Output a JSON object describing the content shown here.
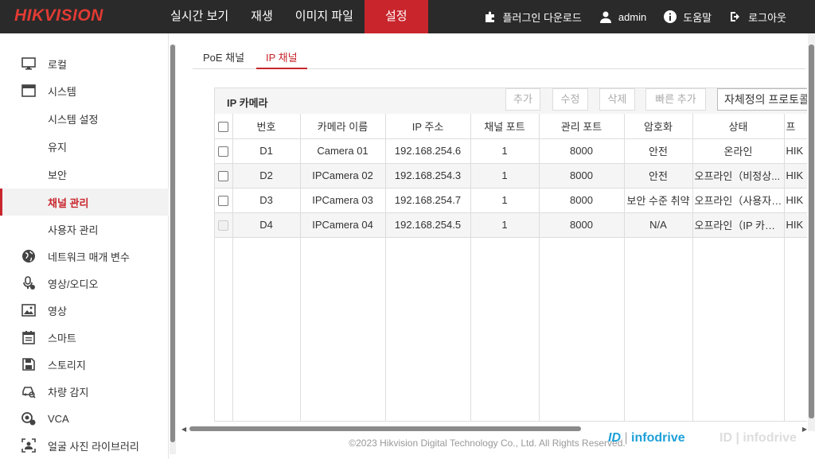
{
  "brand": "HIKVISION",
  "nav": [
    "실시간 보기",
    "재생",
    "이미지 파일",
    "설정"
  ],
  "top_right": {
    "plugin": "플러그인 다운로드",
    "user": "admin",
    "help": "도움말",
    "logout": "로그아웃"
  },
  "sidebar": {
    "items": [
      {
        "label": "로컬",
        "icon": "monitor-icon"
      },
      {
        "label": "시스템",
        "icon": "window-icon"
      },
      {
        "label": "시스템 설정"
      },
      {
        "label": "유지"
      },
      {
        "label": "보안"
      },
      {
        "label": "채널 관리"
      },
      {
        "label": "사용자 관리"
      },
      {
        "label": "네트워크 매개 변수",
        "icon": "globe-icon"
      },
      {
        "label": "영상/오디오",
        "icon": "microphone-icon"
      },
      {
        "label": "영상",
        "icon": "image-icon"
      },
      {
        "label": "스마트",
        "icon": "calendar-icon"
      },
      {
        "label": "스토리지",
        "icon": "floppy-icon"
      },
      {
        "label": "차량 감지",
        "icon": "car-search-icon"
      },
      {
        "label": "VCA",
        "icon": "camera-gear-icon"
      },
      {
        "label": "얼굴 사진 라이브러리",
        "icon": "face-frame-icon"
      }
    ]
  },
  "tabs": [
    "PoE 채널",
    "IP 채널"
  ],
  "panel": {
    "title": "IP 카메라",
    "buttons": [
      "추가",
      "수정",
      "삭제",
      "빠른 추가"
    ],
    "protocol": "자체정의 프로토콜"
  },
  "table": {
    "headers": [
      "번호",
      "카메라 이름",
      "IP 주소",
      "채널 포트",
      "관리 포트",
      "암호화",
      "상태",
      "프"
    ],
    "rows": [
      [
        "D1",
        "Camera 01",
        "192.168.254.6",
        "1",
        "8000",
        "안전",
        "온라인",
        "HIK"
      ],
      [
        "D2",
        "IPCamera 02",
        "192.168.254.3",
        "1",
        "8000",
        "안전",
        "오프라인（비정상...",
        "HIK"
      ],
      [
        "D3",
        "IPCamera 03",
        "192.168.254.7",
        "1",
        "8000",
        "보안 수준 취약",
        "오프라인（사용자 ...",
        "HIK"
      ],
      [
        "D4",
        "IPCamera 04",
        "192.168.254.5",
        "1",
        "8000",
        "N/A",
        "오프라인（IP 카메...",
        "HIK"
      ]
    ]
  },
  "footer": "©2023 Hikvision Digital Technology Co., Ltd. All Rights Reserved.",
  "watermark": {
    "mark": "ID",
    "name": "infodrive"
  },
  "colors": {
    "accent": "#c8252c",
    "topbar": "#2a2a2a",
    "brand": "#e23b34"
  }
}
